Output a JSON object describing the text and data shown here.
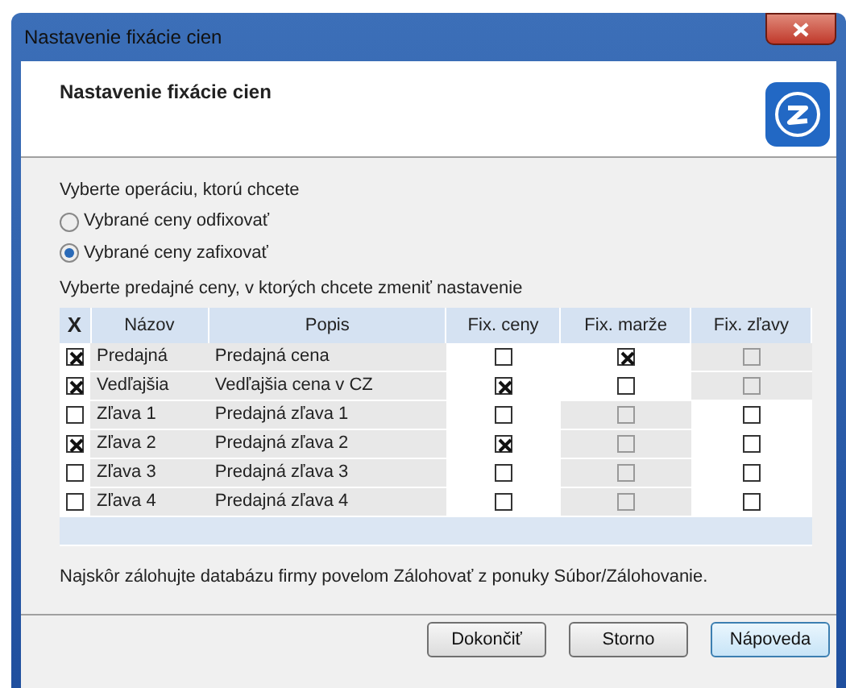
{
  "window": {
    "title": "Nastavenie fixácie cien"
  },
  "header": {
    "title": "Nastavenie fixácie cien"
  },
  "operation": {
    "label": "Vyberte operáciu, ktorú chcete",
    "options": [
      {
        "label": "Vybrané ceny odfixovať",
        "selected": false
      },
      {
        "label": "Vybrané ceny zafixovať",
        "selected": true
      }
    ]
  },
  "prices": {
    "label": "Vyberte predajné ceny, v ktorých chcete zmeniť nastavenie",
    "columns": [
      "X",
      "Názov",
      "Popis",
      "Fix. ceny",
      "Fix. marže",
      "Fix. zľavy"
    ],
    "rows": [
      {
        "checked": true,
        "name": "Predajná",
        "description": "Predajná cena",
        "fix": [
          {
            "checked": false,
            "disabled": false
          },
          {
            "checked": true,
            "disabled": false
          },
          {
            "checked": false,
            "disabled": true
          }
        ]
      },
      {
        "checked": true,
        "name": "Vedľajšia",
        "description": "Vedľajšia cena v CZ",
        "fix": [
          {
            "checked": true,
            "disabled": false
          },
          {
            "checked": false,
            "disabled": false
          },
          {
            "checked": false,
            "disabled": true
          }
        ]
      },
      {
        "checked": false,
        "name": "Zľava 1",
        "description": "Predajná zľava 1",
        "fix": [
          {
            "checked": false,
            "disabled": false
          },
          {
            "checked": false,
            "disabled": true
          },
          {
            "checked": false,
            "disabled": false
          }
        ]
      },
      {
        "checked": true,
        "name": "Zľava 2",
        "description": "Predajná zľava 2",
        "fix": [
          {
            "checked": true,
            "disabled": false
          },
          {
            "checked": false,
            "disabled": true
          },
          {
            "checked": false,
            "disabled": false
          }
        ]
      },
      {
        "checked": false,
        "name": "Zľava 3",
        "description": "Predajná zľava 3",
        "fix": [
          {
            "checked": false,
            "disabled": false
          },
          {
            "checked": false,
            "disabled": true
          },
          {
            "checked": false,
            "disabled": false
          }
        ]
      },
      {
        "checked": false,
        "name": "Zľava 4",
        "description": "Predajná zľava 4",
        "fix": [
          {
            "checked": false,
            "disabled": false
          },
          {
            "checked": false,
            "disabled": true
          },
          {
            "checked": false,
            "disabled": false
          }
        ]
      }
    ]
  },
  "note": "Najskôr zálohujte databázu firmy povelom Zálohovať z ponuky Súbor/Zálohovanie.",
  "buttons": [
    {
      "label": "Dokončiť",
      "kind": "normal"
    },
    {
      "label": "Storno",
      "kind": "normal"
    },
    {
      "label": "Nápoveda",
      "kind": "default"
    }
  ]
}
